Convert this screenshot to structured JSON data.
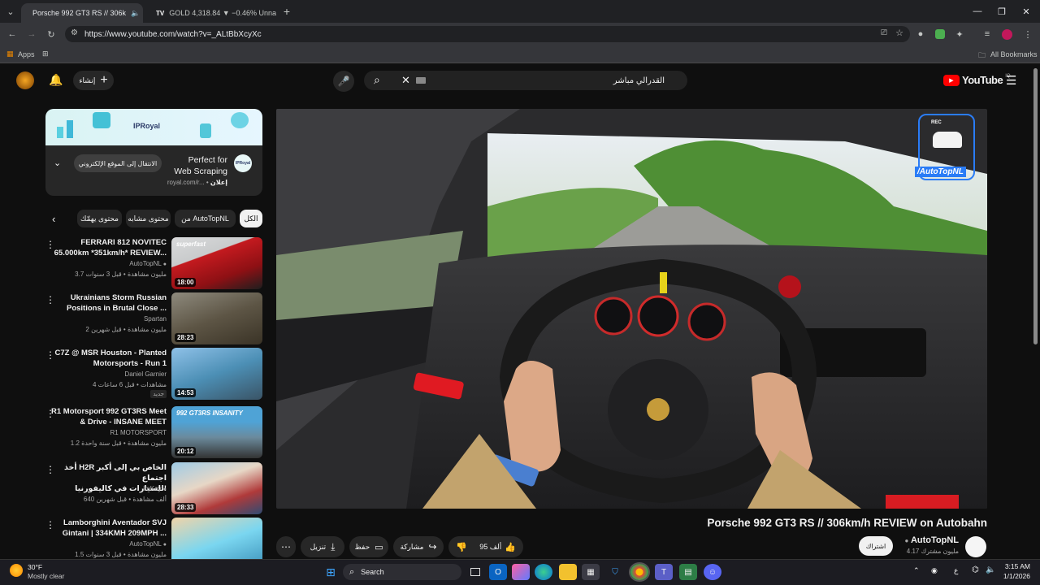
{
  "tabs": [
    {
      "title": "Porsche 992 GT3 RS // 306k",
      "active": true
    },
    {
      "title": "GOLD 4,318.84 ▼ −0.46% Unna",
      "active": false
    }
  ],
  "omnibox": {
    "url": "https://www.youtube.com/watch?v=_ALtBbXcyXc"
  },
  "bookmarks": {
    "apps": "Apps",
    "all": "All Bookmarks"
  },
  "youtube": {
    "logo": "YouTube",
    "region": "IQ",
    "create": "إنشاء",
    "search_value": "القدرالي مباشر"
  },
  "ad": {
    "brand": "IPRoyal",
    "headline_line1": "Perfect for",
    "headline_line2": "Web Scraping",
    "sponsored": "إعلان",
    "domain": "royal.com/r...",
    "cta": "الانتقال إلى الموقع الإلكتروني"
  },
  "chips": [
    "الكل",
    "من AutoTopNL",
    "محتوى مشابه",
    "محتوى يهمّك"
  ],
  "recommendations": [
    {
      "title_line1": "FERRARI 812 NOVITEC",
      "title_line2": "65.000km *351km/h* REVIEW...",
      "channel": "AutoTopNL",
      "meta": "3.7 مليون مشاهدة • قبل 3 سنوات",
      "duration": "18:00",
      "thumb_text": "superfast",
      "verified": true,
      "new": ""
    },
    {
      "title_line1": "Ukrainians Storm Russian",
      "title_line2": "Positions in Brutal Close ...",
      "channel": "Spartan",
      "meta": "2 مليون مشاهدة • قبل شهرين",
      "duration": "28:23",
      "thumb_text": "",
      "verified": false,
      "new": ""
    },
    {
      "title_line1": "C7Z @ MSR Houston - Planted",
      "title_line2": "Motorsports - Run 1",
      "channel": "Daniel Garnier",
      "meta": "4 مشاهدات • قبل 6 ساعات",
      "duration": "14:53",
      "thumb_text": "",
      "verified": false,
      "new": "جديد"
    },
    {
      "title_line1": "R1 Motorsport 992 GT3RS Meet",
      "title_line2": "& Drive - INSANE MEET",
      "channel": "R1 MOTORSPORT",
      "meta": "1.2 مليون مشاهدة • قبل سنة واحدة",
      "duration": "20:12",
      "thumb_text": "992 GT3RS INSANITY",
      "verified": false,
      "new": ""
    },
    {
      "title_line1": "أخذ H2R الخاص بي إلى أكبر اجتماع",
      "title_line2": "للسيارات في كاليفورنيا!",
      "channel": "imKay",
      "meta": "640 ألف مشاهدة • قبل شهرين",
      "duration": "28:33",
      "thumb_text": "",
      "verified": true,
      "new": ""
    },
    {
      "title_line1": "Lamborghini Aventador SVJ",
      "title_line2": "Gintani | 334KMH 209MPH ...",
      "channel": "AutoTopNL",
      "meta": "1.5 مليون مشاهدة • قبل 3 سنوات",
      "duration": "",
      "thumb_text": "",
      "verified": true,
      "new": ""
    }
  ],
  "player": {
    "watermark": "/AutoTopNL",
    "rec": "REC"
  },
  "video": {
    "title": "Porsche 992 GT3 RS // 306km/h REVIEW on Autobahn",
    "channel": "AutoTopNL",
    "subscribers": "4.17 مليون مشترك",
    "subscribe": "اشتراك",
    "likes": "95 ألف",
    "share": "مشاركة",
    "save": "حفظ",
    "download": "تنزيل"
  },
  "taskbar": {
    "temp": "30°F",
    "weather": "Mostly clear",
    "search": "Search",
    "time": "3:15 AM",
    "date": "1/1/2026",
    "lang": "ع"
  },
  "colors": {
    "yt_red": "#ff0000",
    "accent_blue": "#3ea6ff",
    "bg": "#0f0f0f"
  }
}
